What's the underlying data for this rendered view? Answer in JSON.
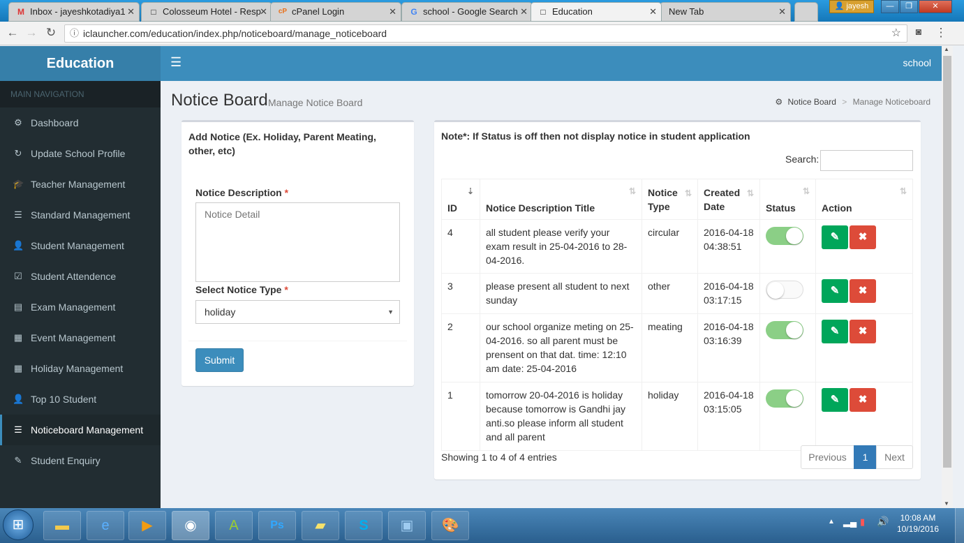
{
  "browser": {
    "tabs": [
      {
        "label": "Inbox - jayeshkotadiya1",
        "icon": "M"
      },
      {
        "label": "Colosseum Hotel - Resp",
        "icon": "□"
      },
      {
        "label": "cPanel Login",
        "icon": "cP"
      },
      {
        "label": "school - Google Search",
        "icon": "G"
      },
      {
        "label": "Education",
        "icon": "□"
      },
      {
        "label": "New Tab",
        "icon": ""
      }
    ],
    "user": "jayesh",
    "url": "iclauncher.com/education/index.php/noticeboard/manage_noticeboard"
  },
  "app": {
    "logo": "Education",
    "main_nav_label": "MAIN NAVIGATION",
    "user": "school",
    "menu": [
      {
        "label": "Dashboard",
        "icon": "⚙"
      },
      {
        "label": "Update School Profile",
        "icon": "↻"
      },
      {
        "label": "Teacher Management",
        "icon": "🎓"
      },
      {
        "label": "Standard Management",
        "icon": "☰"
      },
      {
        "label": "Student Management",
        "icon": "👤"
      },
      {
        "label": "Student Attendence",
        "icon": "☑"
      },
      {
        "label": "Exam Management",
        "icon": "▤"
      },
      {
        "label": "Event Management",
        "icon": "▦"
      },
      {
        "label": "Holiday Management",
        "icon": "▦"
      },
      {
        "label": "Top 10 Student",
        "icon": "👤"
      },
      {
        "label": "Noticeboard Management",
        "icon": "☰"
      },
      {
        "label": "Student Enquiry",
        "icon": "✎"
      }
    ],
    "active_menu": "Noticeboard Management"
  },
  "page": {
    "title": "Notice Board",
    "subtitle": "Manage Notice Board",
    "breadcrumb": [
      "Notice Board",
      "Manage Noticeboard"
    ]
  },
  "form": {
    "heading": "Add Notice (Ex. Holiday, Parent Meating, other, etc)",
    "desc_label": "Notice Description",
    "desc_placeholder": "Notice Detail",
    "type_label": "Select Notice Type",
    "type_value": "holiday",
    "required_mark": "*",
    "submit": "Submit"
  },
  "table": {
    "note": "Note*: If Status is off then not display notice in student application",
    "search_label": "Search:",
    "columns": [
      "ID",
      "Notice Description Title",
      "Notice Type",
      "Created Date",
      "Status",
      "Action"
    ],
    "rows": [
      {
        "id": "4",
        "title": "all student please verify your exam result in 25-04-2016 to 28-04-2016.",
        "type": "circular",
        "created": "2016-04-18 04:38:51",
        "status": "on"
      },
      {
        "id": "3",
        "title": "please present all student to next sunday",
        "type": "other",
        "created": "2016-04-18 03:17:15",
        "status": "off"
      },
      {
        "id": "2",
        "title": "our school organize meting on 25-04-2016. so all parent must be prensent on that dat. time: 12:10 am date: 25-04-2016",
        "type": "meating",
        "created": "2016-04-18 03:16:39",
        "status": "on"
      },
      {
        "id": "1",
        "title": "tomorrow 20-04-2016 is holiday because tomorrow is Gandhi jay anti.so please inform all student and all parent",
        "type": "holiday",
        "created": "2016-04-18 03:15:05",
        "status": "on"
      }
    ],
    "info": "Showing 1 to 4 of 4 entries",
    "pagination": {
      "previous": "Previous",
      "current": "1",
      "next": "Next"
    }
  },
  "taskbar": {
    "time": "10:08 AM",
    "date": "10/19/2016"
  },
  "colors": {
    "accent": "#3c8dbc",
    "sidebar": "#222d32",
    "success": "#00a65a",
    "danger": "#dd4b39"
  }
}
